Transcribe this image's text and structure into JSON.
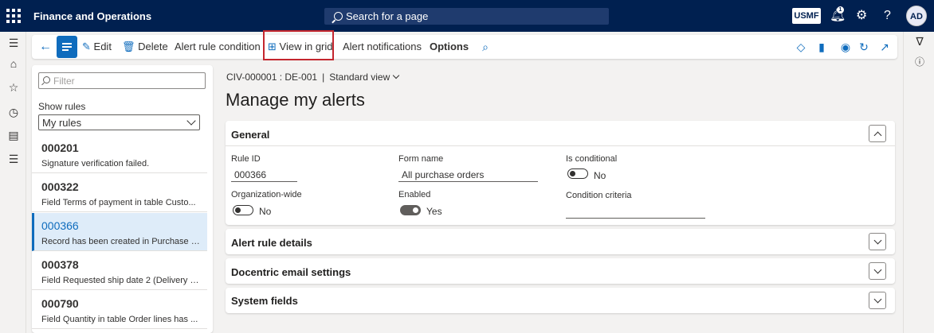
{
  "app": {
    "title": "Finance and Operations",
    "search_placeholder": "Search for a page",
    "company": "USMF",
    "user_initials": "AD",
    "notification_count": "1"
  },
  "actions": {
    "edit": "Edit",
    "delete": "Delete",
    "alert_rule_condition": "Alert rule condition",
    "view_in_grid": "View in grid",
    "alert_notifications": "Alert notifications",
    "options": "Options"
  },
  "list": {
    "filter_placeholder": "Filter",
    "show_rules_label": "Show rules",
    "show_rules_value": "My rules",
    "items": [
      {
        "id": "000201",
        "desc": "Signature verification failed."
      },
      {
        "id": "000322",
        "desc": "Field Terms of payment in table Custo..."
      },
      {
        "id": "000366",
        "desc": "Record has been created in Purchase ord"
      },
      {
        "id": "000378",
        "desc": "Field Requested ship date 2 (Delivery d..."
      },
      {
        "id": "000790",
        "desc": "Field Quantity in table Order lines has ..."
      }
    ],
    "selected_index": 2
  },
  "header": {
    "record": "CIV-000001 : DE-001",
    "separator": "|",
    "view": "Standard view",
    "title": "Manage my alerts"
  },
  "general": {
    "title": "General",
    "rule_id_label": "Rule ID",
    "rule_id": "000366",
    "form_name_label": "Form name",
    "form_name": "All purchase orders",
    "is_conditional_label": "Is conditional",
    "is_conditional": "No",
    "org_wide_label": "Organization-wide",
    "org_wide": "No",
    "enabled_label": "Enabled",
    "enabled": "Yes",
    "condition_criteria_label": "Condition criteria",
    "condition_criteria": ""
  },
  "sections": {
    "alert_rule_details": "Alert rule details",
    "docentric": "Docentric email settings",
    "system_fields": "System fields"
  },
  "colors": {
    "topbar": "#002050",
    "accent": "#0f6cbd",
    "highlight": "#c4262e"
  }
}
